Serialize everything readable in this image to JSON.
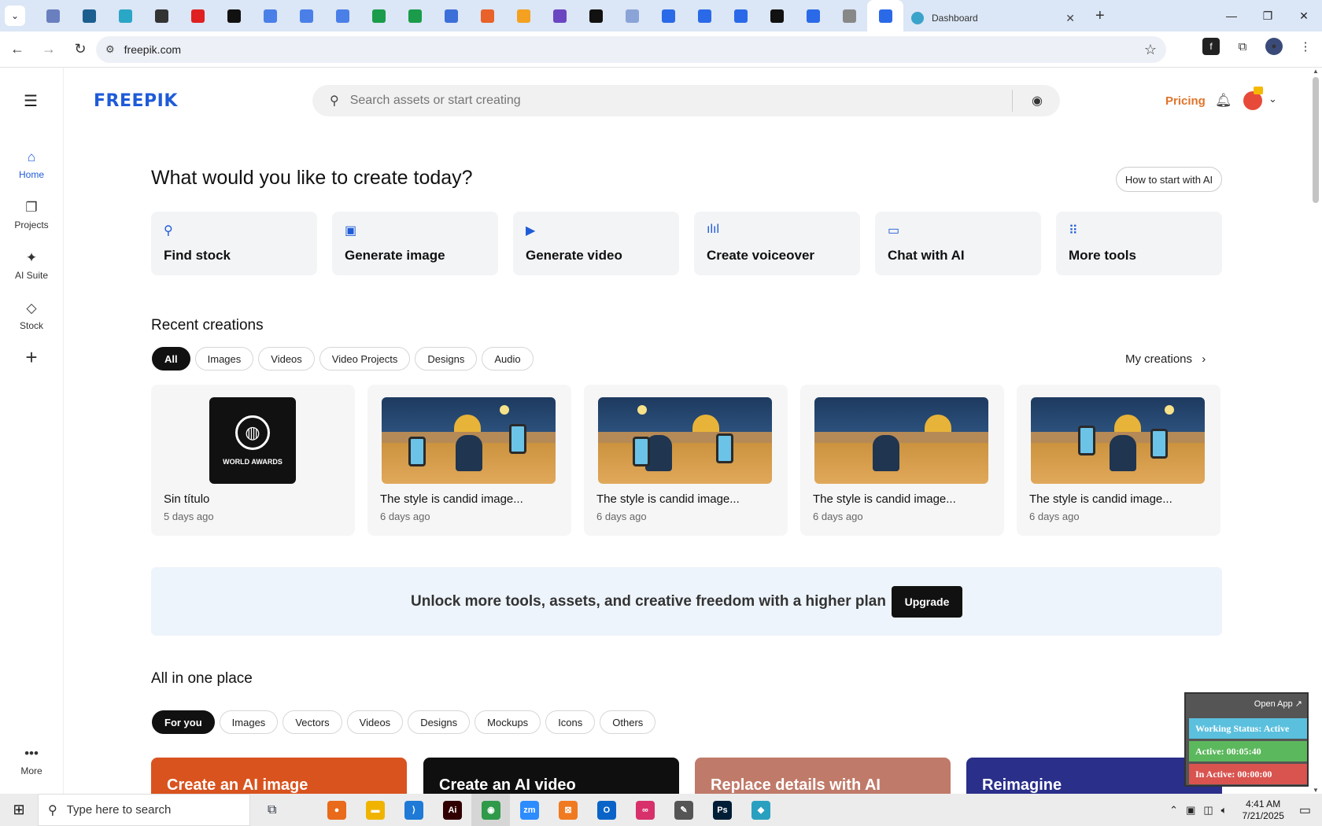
{
  "browser": {
    "active_tab_title": "Dashboard",
    "url": "freepik.com",
    "tab_icons": [
      "#6a7fbf",
      "#1c5f8f",
      "#2aa6c6",
      "#333333",
      "#e02020",
      "#111111",
      "#4a7fe8",
      "#4a7fe8",
      "#4a7fe8",
      "#1a9c4a",
      "#1a9c4a",
      "#3d6fd8",
      "#e8622a",
      "#f4a020",
      "#6b46c1",
      "#111111",
      "#8aa4d8",
      "#2a6ae8",
      "#2a6ae8",
      "#2a6ae8",
      "#111111",
      "#2a6ae8",
      "#888888",
      "#2a6ae8"
    ]
  },
  "sidebar": {
    "items": [
      {
        "label": "Home",
        "icon": "home-icon"
      },
      {
        "label": "Projects",
        "icon": "projects-icon"
      },
      {
        "label": "AI Suite",
        "icon": "sparkles-icon"
      },
      {
        "label": "Stock",
        "icon": "shapes-icon"
      }
    ],
    "more_label": "More"
  },
  "header": {
    "logo": "FREEPIK",
    "search_placeholder": "Search assets or start creating",
    "pricing": "Pricing"
  },
  "main": {
    "question": "What would you like to create today?",
    "how_to": "How to start with AI",
    "tools": [
      {
        "label": "Find stock",
        "icon": "search-icon"
      },
      {
        "label": "Generate image",
        "icon": "image-icon"
      },
      {
        "label": "Generate video",
        "icon": "video-icon"
      },
      {
        "label": "Create voiceover",
        "icon": "waveform-icon"
      },
      {
        "label": "Chat with AI",
        "icon": "chat-icon"
      },
      {
        "label": "More tools",
        "icon": "grid-icon"
      }
    ],
    "recent_title": "Recent creations",
    "recent_chips": [
      "All",
      "Images",
      "Videos",
      "Video Projects",
      "Designs",
      "Audio"
    ],
    "my_creations": "My creations",
    "award_text": "WORLD AWARDS",
    "cards": [
      {
        "title": "Sin título",
        "date": "5 days ago"
      },
      {
        "title": "The style is candid image...",
        "date": "6 days ago"
      },
      {
        "title": "The style is candid image...",
        "date": "6 days ago"
      },
      {
        "title": "The style is candid image...",
        "date": "6 days ago"
      },
      {
        "title": "The style is candid image...",
        "date": "6 days ago"
      }
    ],
    "banner_text": "Unlock more tools, assets, and creative freedom with a higher plan",
    "upgrade": "Upgrade",
    "all_title": "All in one place",
    "all_chips": [
      "For you",
      "Images",
      "Vectors",
      "Videos",
      "Designs",
      "Mockups",
      "Icons",
      "Others"
    ],
    "promos": [
      {
        "label": "Create an AI image",
        "color": "#d9531e"
      },
      {
        "label": "Create an AI video",
        "color": "#0f0f0f"
      },
      {
        "label": "Replace details with AI",
        "color": "#c07a6a"
      },
      {
        "label": "Reimagine",
        "color": "#2a2f8a"
      }
    ]
  },
  "tracker": {
    "open_app": "Open App ↗",
    "working": "Working Status: Active",
    "active": "Active: 00:05:40",
    "inactive": "In Active: 00:00:00"
  },
  "taskbar": {
    "search": "Type here to search",
    "time": "4:41 AM",
    "date": "7/21/2025",
    "apps": [
      {
        "name": "firefox",
        "color": "#e86a1a",
        "glyph": "●"
      },
      {
        "name": "file-explorer",
        "color": "#f0b400",
        "glyph": "▬"
      },
      {
        "name": "vscode",
        "color": "#1e7ad6",
        "glyph": "⟩"
      },
      {
        "name": "illustrator",
        "color": "#310000",
        "glyph": "Ai"
      },
      {
        "name": "chrome",
        "color": "#2f9a4a",
        "glyph": "◉"
      },
      {
        "name": "zoom",
        "color": "#2d8cff",
        "glyph": "zm"
      },
      {
        "name": "xampp",
        "color": "#f07a20",
        "glyph": "⊠"
      },
      {
        "name": "outlook",
        "color": "#0a64c8",
        "glyph": "O"
      },
      {
        "name": "creative-cloud",
        "color": "#d8306a",
        "glyph": "∞"
      },
      {
        "name": "pen-tool",
        "color": "#555555",
        "glyph": "✎"
      },
      {
        "name": "photoshop",
        "color": "#001e36",
        "glyph": "Ps"
      },
      {
        "name": "app-diamond",
        "color": "#2aa0c0",
        "glyph": "◆"
      }
    ]
  }
}
